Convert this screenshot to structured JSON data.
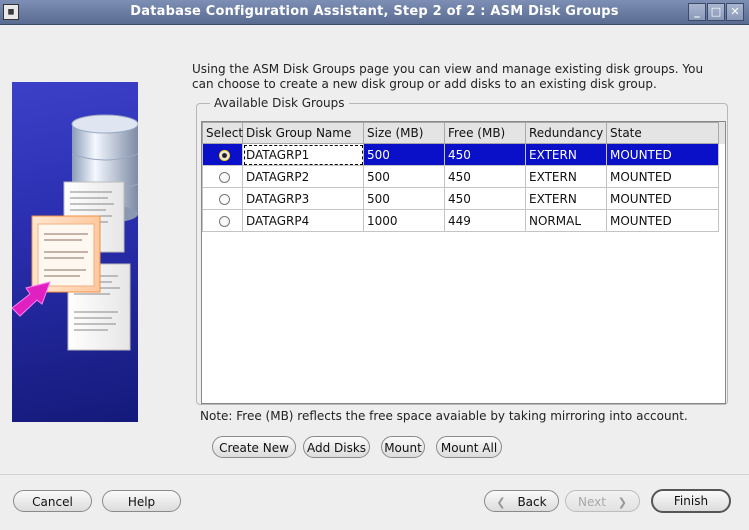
{
  "window": {
    "title": "Database Configuration Assistant, Step 2 of 2 : ASM Disk Groups",
    "app_icon": "terminal-icon",
    "controls": [
      "minimize-icon",
      "maximize-icon",
      "close-icon"
    ]
  },
  "intro_text": "Using the ASM Disk Groups page you can view and manage existing disk groups. You can choose to create a new disk group or add disks to an existing disk group.",
  "group_title": "Available Disk Groups",
  "table": {
    "headers": [
      "Select",
      "Disk Group Name",
      "Size (MB)",
      "Free (MB)",
      "Redundancy",
      "State"
    ],
    "rows": [
      {
        "selected": true,
        "name": "DATAGRP1",
        "size": "500",
        "free": "450",
        "redundancy": "EXTERN",
        "state": "MOUNTED"
      },
      {
        "selected": false,
        "name": "DATAGRP2",
        "size": "500",
        "free": "450",
        "redundancy": "EXTERN",
        "state": "MOUNTED"
      },
      {
        "selected": false,
        "name": "DATAGRP3",
        "size": "500",
        "free": "450",
        "redundancy": "EXTERN",
        "state": "MOUNTED"
      },
      {
        "selected": false,
        "name": "DATAGRP4",
        "size": "1000",
        "free": "449",
        "redundancy": "NORMAL",
        "state": "MOUNTED"
      }
    ]
  },
  "note": "Note: Free (MB) reflects the free space avaiable by taking mirroring into account.",
  "actions": {
    "create_new": "Create New",
    "add_disks": "Add Disks",
    "mount": "Mount",
    "mount_all": "Mount All"
  },
  "footer": {
    "cancel": "Cancel",
    "help": "Help",
    "back": "Back",
    "next": "Next",
    "finish": "Finish"
  },
  "colors": {
    "title_bar": "#5a6b92",
    "selection": "#0a10c8",
    "side_panel": "#2a2fb0",
    "arrow": "#e020c0"
  }
}
